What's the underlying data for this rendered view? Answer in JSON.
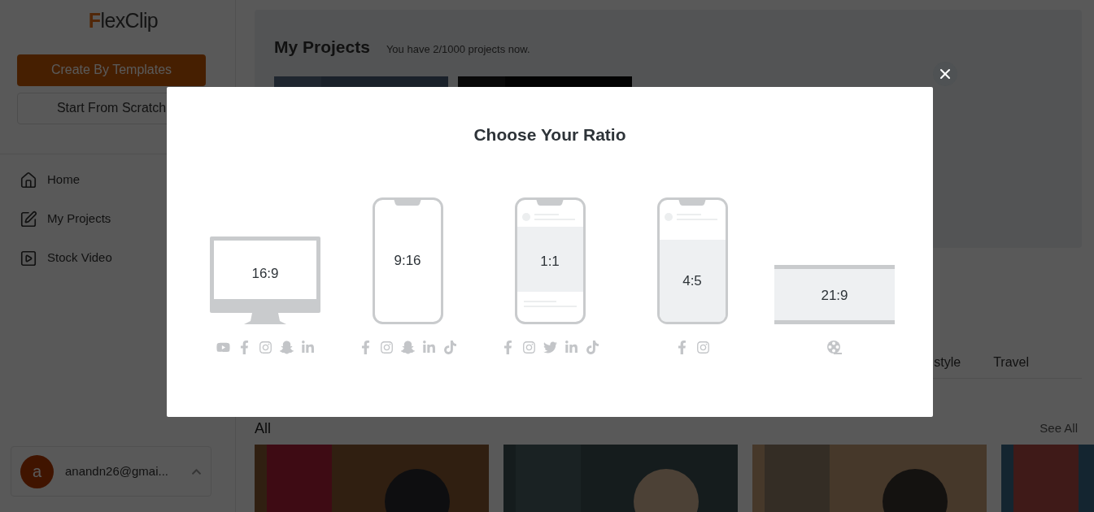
{
  "sidebar": {
    "logo": "FlexClip",
    "buttons": [
      {
        "label": "Create By Templates",
        "kind": "primary"
      },
      {
        "label": "Start From Scratch",
        "kind": "outline"
      }
    ],
    "nav": [
      {
        "label": "Home",
        "kind": "home"
      },
      {
        "label": "My Projects",
        "kind": "projects"
      },
      {
        "label": "Stock Video",
        "kind": "video"
      }
    ],
    "user": {
      "avatar": "a",
      "email": "anandn26@gmai...",
      "expanded": true
    }
  },
  "projects": {
    "title": "My Projects",
    "subtitle": "You have 2/1000 projects now."
  },
  "category_tabs": [
    {
      "label": "style",
      "selected": false
    },
    {
      "label": "Travel",
      "selected": false
    }
  ],
  "section": {
    "title": "All",
    "link": "See All"
  },
  "dialog": {
    "title": "Choose Your Ratio",
    "ratios": [
      {
        "label": "16:9",
        "kind": "monitor",
        "icons": [
          {
            "kind": "youtube"
          },
          {
            "kind": "facebook"
          },
          {
            "kind": "instagram"
          },
          {
            "kind": "snapchat"
          },
          {
            "kind": "linkedin"
          }
        ]
      },
      {
        "label": "9:16",
        "kind": "phone",
        "icons": [
          {
            "kind": "facebook"
          },
          {
            "kind": "instagram"
          },
          {
            "kind": "snapchat"
          },
          {
            "kind": "linkedin"
          },
          {
            "kind": "tiktok"
          }
        ]
      },
      {
        "label": "1:1",
        "kind": "square_post",
        "icons": [
          {
            "kind": "facebook"
          },
          {
            "kind": "instagram"
          },
          {
            "kind": "twitter"
          },
          {
            "kind": "linkedin"
          },
          {
            "kind": "tiktok"
          }
        ]
      },
      {
        "label": "4:5",
        "kind": "portrait_post",
        "icons": [
          {
            "kind": "facebook"
          },
          {
            "kind": "instagram"
          }
        ]
      },
      {
        "label": "21:9",
        "kind": "widescreen",
        "icons": [
          {
            "kind": "film"
          }
        ]
      }
    ]
  }
}
